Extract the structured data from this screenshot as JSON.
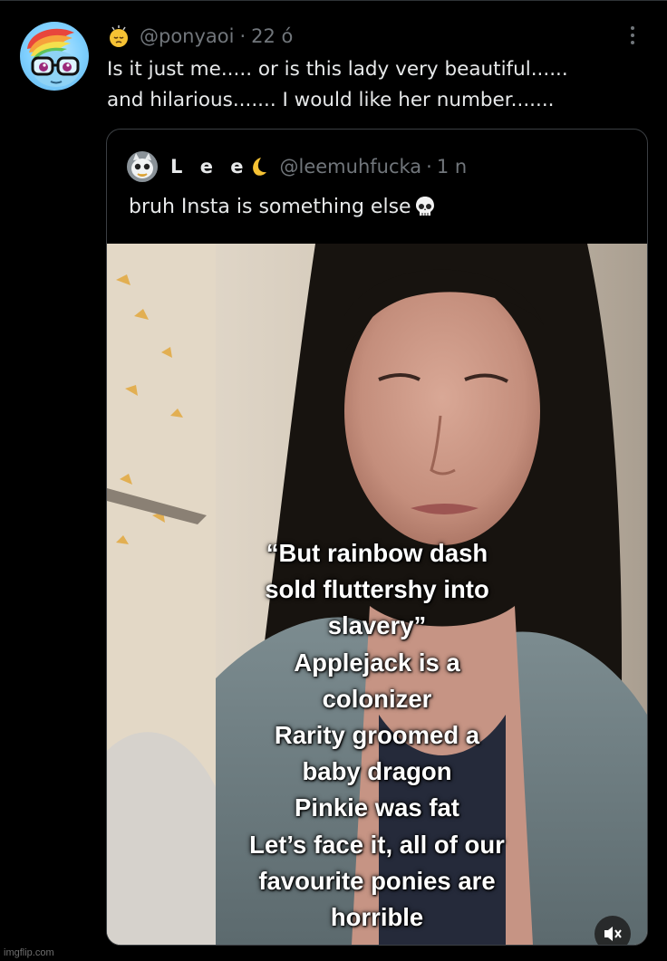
{
  "tweet": {
    "handle": "@ponyaoi",
    "separator": "·",
    "time": "22 ó",
    "lines": [
      "Is it just me..... or is this lady very beautiful......",
      "and hilarious....... I would like her number......."
    ],
    "icons": {
      "emoji": "pensive-face-emoji-icon",
      "more": "more-options-icon"
    }
  },
  "quote": {
    "name": "L e e",
    "handle": "@leemuhfucka",
    "separator": "·",
    "time": "1 n",
    "text": "bruh Insta is something else",
    "icons": {
      "name_emoji": "crescent-moon-icon",
      "text_emoji": "skull-icon"
    },
    "media": {
      "caption_lines": [
        "“But rainbow dash",
        "sold fluttershy into",
        "slavery”",
        "Applejack is a",
        "colonizer",
        "Rarity groomed a",
        "baby dragon",
        "Pinkie was fat",
        "Let’s face it, all of our",
        "favourite ponies are",
        "horrible"
      ]
    }
  },
  "watermark": "imgflip.com",
  "colors": {
    "background": "#000000",
    "text": "#e7e9ea",
    "muted": "#71767b",
    "border": "#3b3f43"
  }
}
